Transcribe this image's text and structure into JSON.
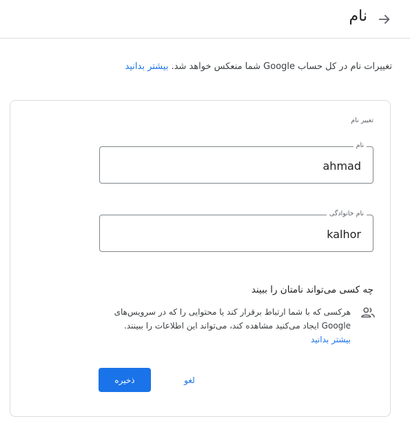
{
  "header": {
    "title": "نام",
    "back_icon": "arrow-right-icon"
  },
  "intro": {
    "text": "تغییرات نام در کل حساب Google شما منعکس خواهد شد. ",
    "learn_more": "بیشتر بدانید"
  },
  "card": {
    "title": "تغییر نام",
    "first_name": {
      "label": "نام",
      "value": "ahmad"
    },
    "last_name": {
      "label": "نام خانوادگی",
      "value": "kalhor"
    },
    "who": {
      "heading": "چه کسی می‌تواند نامتان را ببیند",
      "icon": "people-icon",
      "description": "هرکسی که با شما ارتباط برقرار کند یا محتوایی را که در سرویس‌های Google ایجاد می‌کنید مشاهده کند، می‌تواند این اطلاعات را ببینند. ",
      "learn_more": "بیشتر بدانید"
    },
    "save_label": "ذخیره",
    "cancel_label": "لغو"
  },
  "colors": {
    "accent": "#1a73e8",
    "border": "#dadce0"
  }
}
